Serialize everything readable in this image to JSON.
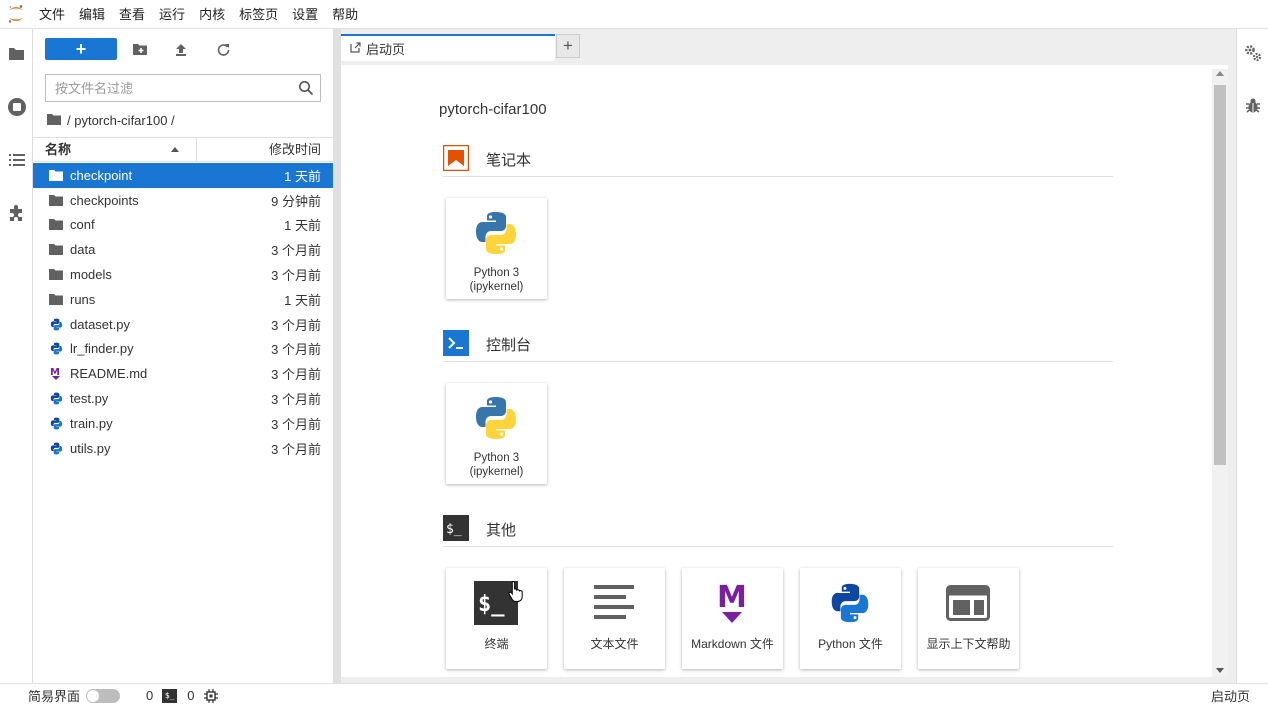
{
  "menubar": {
    "items": [
      "文件",
      "编辑",
      "查看",
      "运行",
      "内核",
      "标签页",
      "设置",
      "帮助"
    ]
  },
  "filebrowser": {
    "new_label": "+",
    "filter_placeholder": "按文件名过滤",
    "breadcrumb": "/ pytorch-cifar100 /",
    "header": {
      "name": "名称",
      "modified": "修改时间"
    },
    "files": [
      {
        "name": "checkpoint",
        "modified": "1 天前",
        "type": "folder",
        "selected": true
      },
      {
        "name": "checkpoints",
        "modified": "9 分钟前",
        "type": "folder"
      },
      {
        "name": "conf",
        "modified": "1 天前",
        "type": "folder"
      },
      {
        "name": "data",
        "modified": "3 个月前",
        "type": "folder"
      },
      {
        "name": "models",
        "modified": "3 个月前",
        "type": "folder"
      },
      {
        "name": "runs",
        "modified": "1 天前",
        "type": "folder"
      },
      {
        "name": "dataset.py",
        "modified": "3 个月前",
        "type": "python"
      },
      {
        "name": "lr_finder.py",
        "modified": "3 个月前",
        "type": "python"
      },
      {
        "name": "README.md",
        "modified": "3 个月前",
        "type": "markdown"
      },
      {
        "name": "test.py",
        "modified": "3 个月前",
        "type": "python"
      },
      {
        "name": "train.py",
        "modified": "3 个月前",
        "type": "python"
      },
      {
        "name": "utils.py",
        "modified": "3 个月前",
        "type": "python"
      }
    ]
  },
  "tabs": {
    "launcher_label": "启动页",
    "add_label": "+"
  },
  "launcher": {
    "cwd": "pytorch-cifar100",
    "sections": {
      "notebook": {
        "title": "笔记本",
        "cards": [
          {
            "line1": "Python 3",
            "line2": "(ipykernel)"
          }
        ]
      },
      "console": {
        "title": "控制台",
        "cards": [
          {
            "line1": "Python 3",
            "line2": "(ipykernel)"
          }
        ]
      },
      "other": {
        "title": "其他",
        "cards": [
          {
            "label": "终端"
          },
          {
            "label": "文本文件"
          },
          {
            "label": "Markdown 文件"
          },
          {
            "label": "Python 文件"
          },
          {
            "label": "显示上下文帮助"
          }
        ]
      }
    }
  },
  "statusbar": {
    "simple_mode_label": "简易界面",
    "kernel_count": "0",
    "terminal_icon_text": "$_",
    "terminal_count": "0",
    "right_label": "启动页"
  },
  "colors": {
    "accent": "#1976d2",
    "notebook_icon": "#e65100",
    "console_icon": "#1976d2",
    "markdown": "#7b1fa2"
  }
}
